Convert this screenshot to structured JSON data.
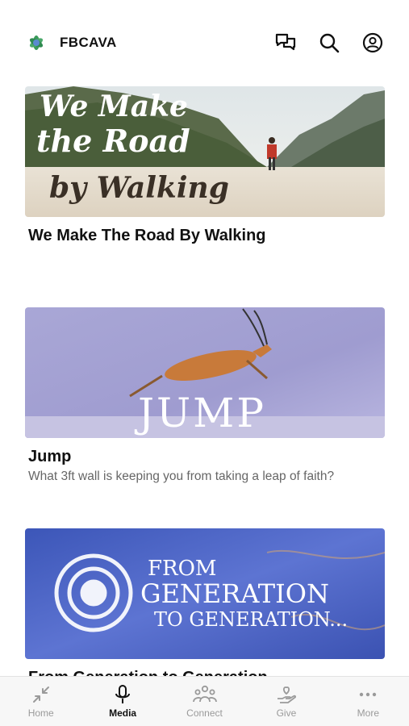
{
  "status_bar": {
    "time": ""
  },
  "header": {
    "brand_name": "FBCAVA",
    "icons": [
      "chat-icon",
      "search-icon",
      "account-icon"
    ]
  },
  "feed": {
    "items": [
      {
        "title": "We Make The Road By Walking",
        "subtitle": "",
        "thumbnail_lines": [
          "We Make",
          "the Road",
          "by Walking"
        ]
      },
      {
        "title": "Jump",
        "subtitle": "What 3ft wall is keeping you from taking a leap of faith?",
        "thumbnail_lines": [
          "JUMP"
        ]
      },
      {
        "title": "From Generation to Generation",
        "subtitle": "",
        "thumbnail_lines": [
          "FROM",
          "GENERATION",
          "TO GENERATION..."
        ]
      }
    ]
  },
  "tabbar": {
    "tabs": [
      {
        "label": "Home",
        "icon": "collapse-arrows-icon",
        "active": false
      },
      {
        "label": "Media",
        "icon": "microphone-icon",
        "active": true
      },
      {
        "label": "Connect",
        "icon": "people-icon",
        "active": false
      },
      {
        "label": "Give",
        "icon": "heart-hand-icon",
        "active": false
      },
      {
        "label": "More",
        "icon": "more-dots-icon",
        "active": false
      }
    ]
  },
  "colors": {
    "accent": "#111111",
    "inactive": "#9a9a9a",
    "brand_green": "#3a9a5a"
  }
}
